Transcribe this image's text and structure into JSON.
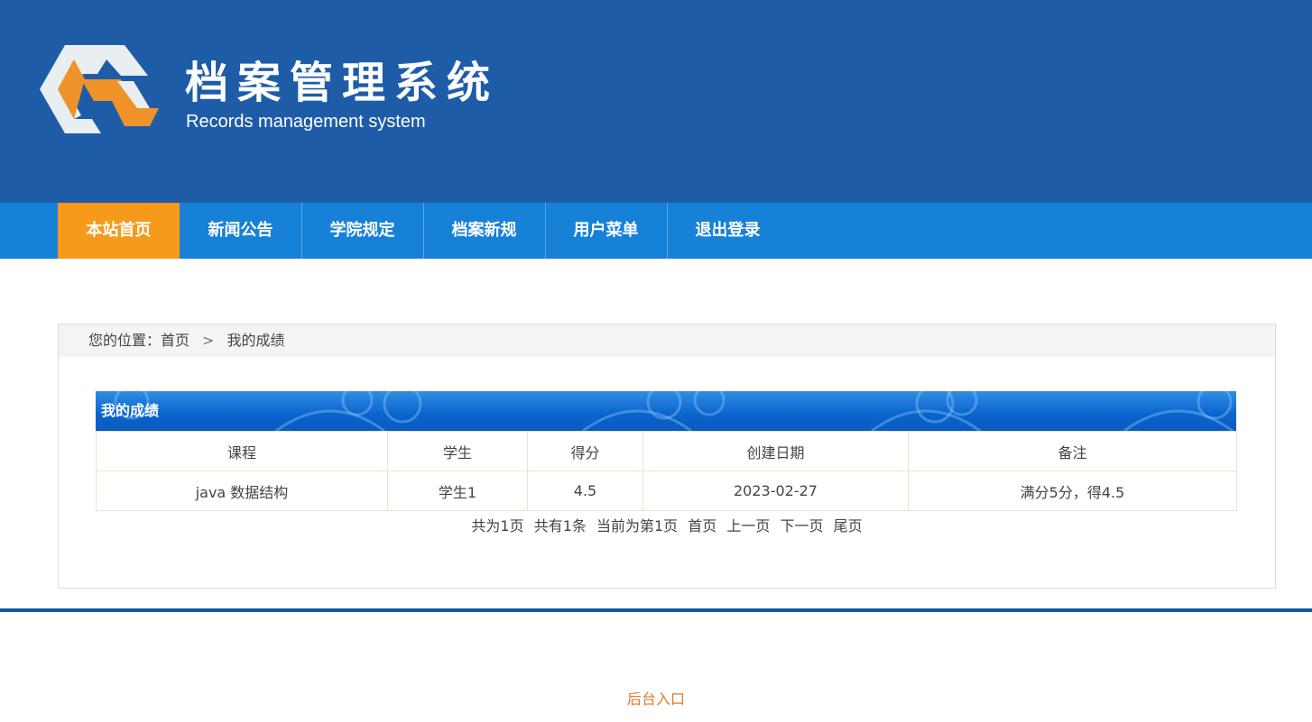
{
  "header": {
    "title": "档案管理系统",
    "subtitle": "Records management system",
    "logo_icon": "hexagon-logo-icon",
    "background": "#1e5ca8"
  },
  "nav": {
    "items": [
      {
        "label": "本站首页",
        "active": true
      },
      {
        "label": "新闻公告",
        "active": false
      },
      {
        "label": "学院规定",
        "active": false
      },
      {
        "label": "档案新规",
        "active": false
      },
      {
        "label": "用户菜单",
        "active": false
      },
      {
        "label": "退出登录",
        "active": false
      }
    ],
    "active_color": "#f59a1b",
    "bar_color": "#1781d8"
  },
  "breadcrumb": {
    "prefix": "您的位置：",
    "home": "首页",
    "separator": ">",
    "current": "我的成绩"
  },
  "grades": {
    "title": "我的成绩",
    "columns": [
      "课程",
      "学生",
      "得分",
      "创建日期",
      "备注"
    ],
    "rows": [
      [
        "java 数据结构",
        "学生1",
        "4.5",
        "2023-02-27",
        "满分5分，得4.5"
      ]
    ]
  },
  "pager": {
    "total_pages": "共为1页",
    "total_items": "共有1条",
    "current_page": "当前为第1页",
    "first": "首页",
    "prev": "上一页",
    "next": "下一页",
    "last": "尾页"
  },
  "footer": {
    "admin_link": "后台入口",
    "link_color": "#e07b2b"
  }
}
